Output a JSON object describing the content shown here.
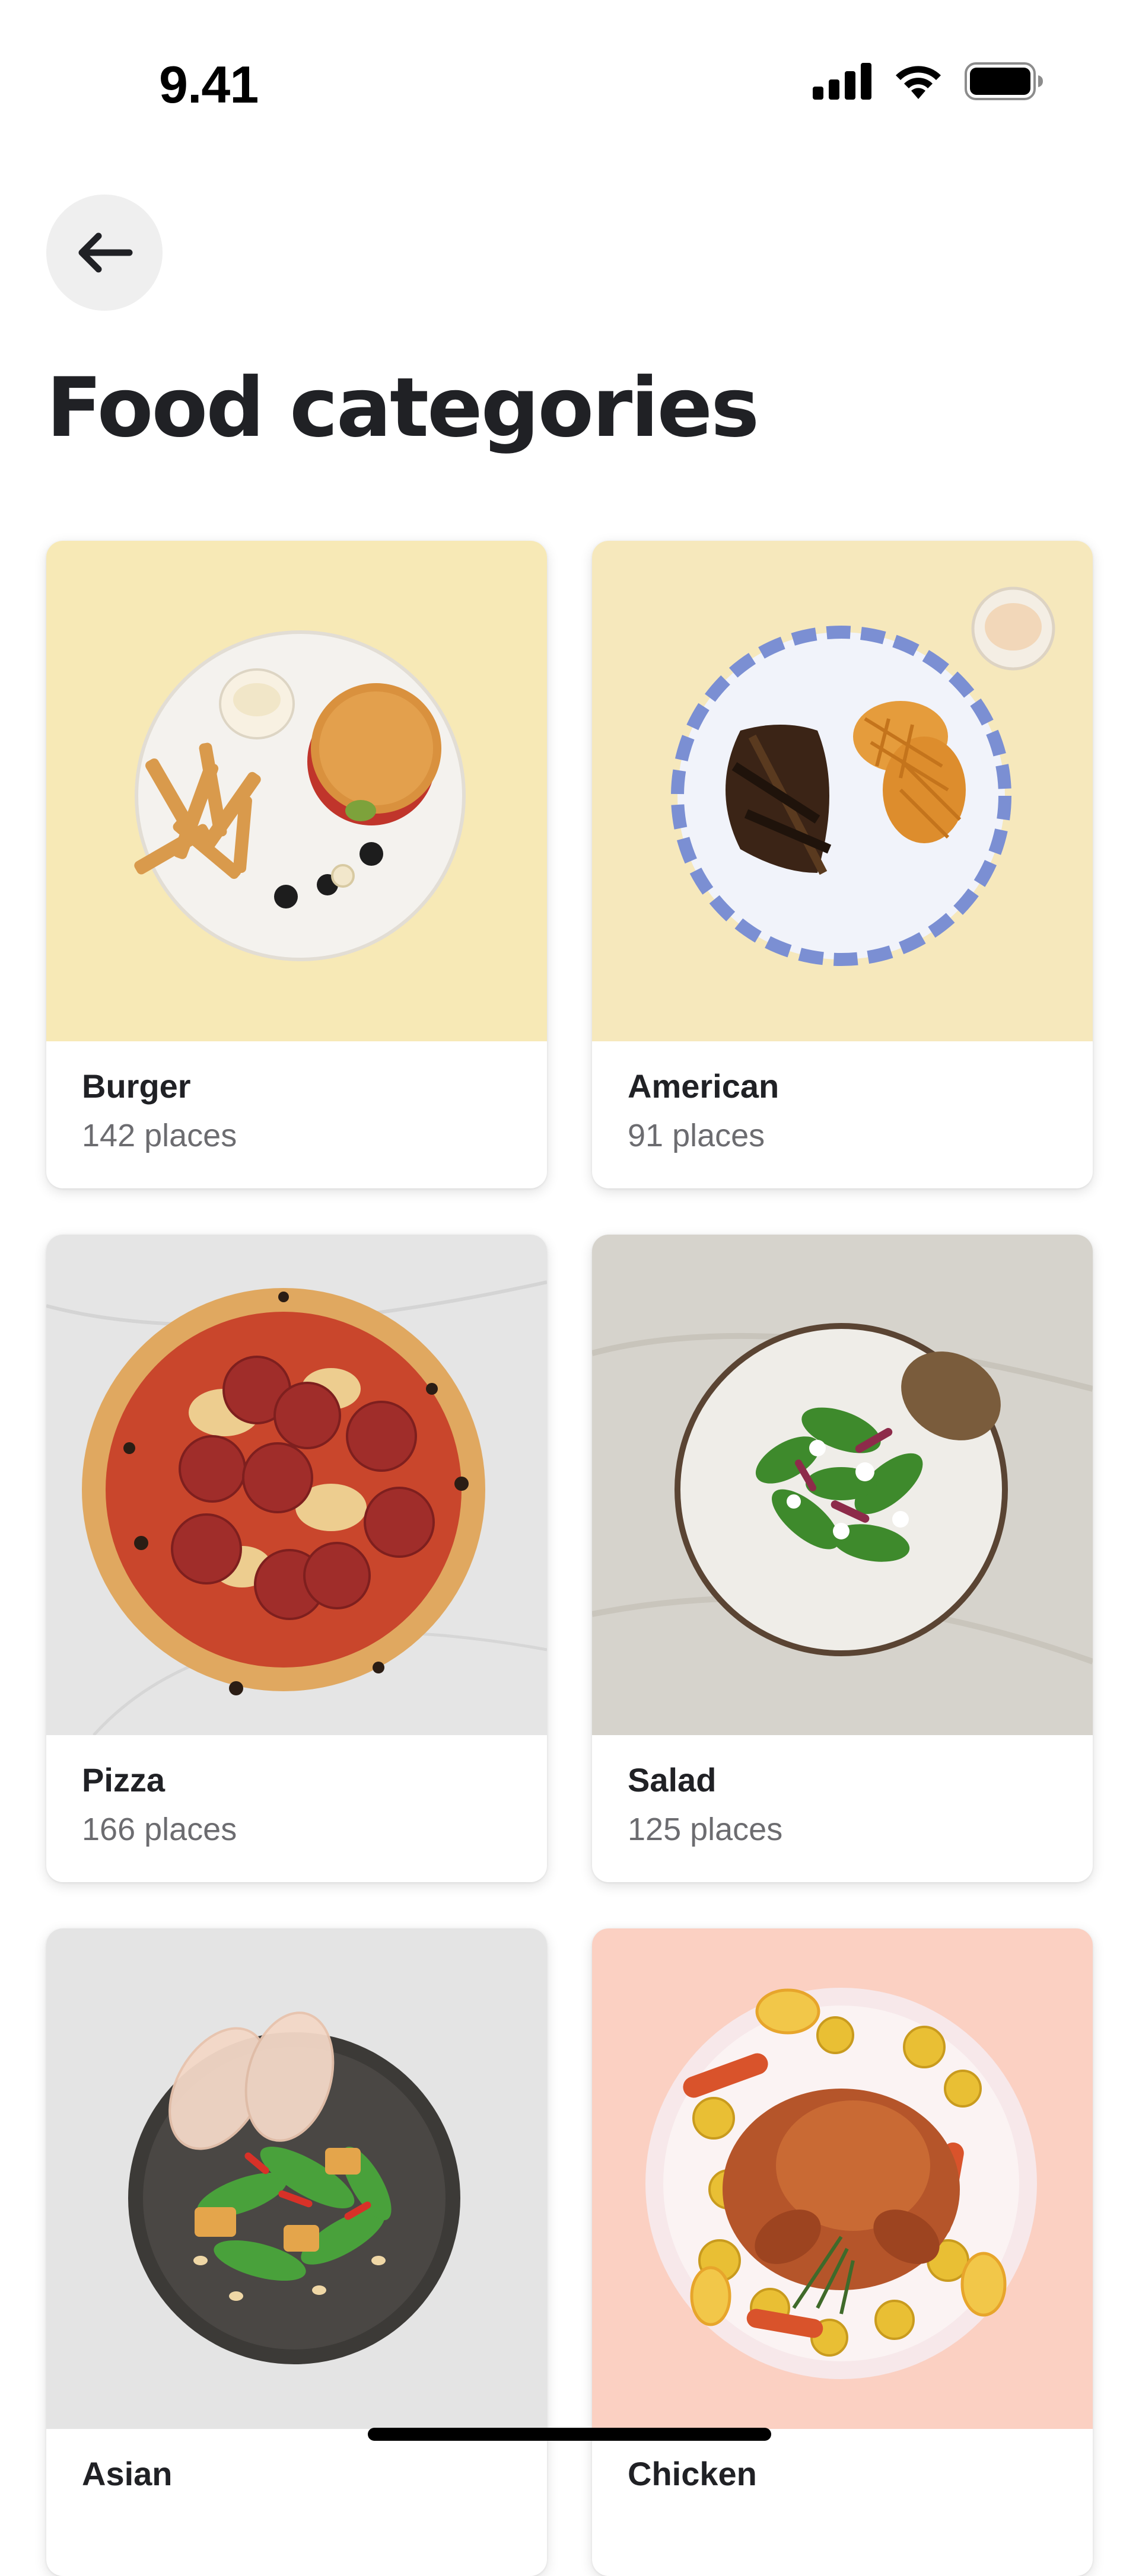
{
  "status_bar": {
    "time": "9.41",
    "icons": [
      "signal-icon",
      "wifi-icon",
      "battery-icon"
    ]
  },
  "header": {
    "back_icon": "arrow-left-icon",
    "title": "Food categories"
  },
  "categories": [
    {
      "name": "Burger",
      "count": "142 places",
      "bg_color": "#f7e9b6",
      "image": "burger-and-fries-plate"
    },
    {
      "name": "American",
      "count": "91 places",
      "bg_color": "#f6e8bc",
      "image": "ribs-and-waffle-fries-plate"
    },
    {
      "name": "Pizza",
      "count": "166 places",
      "bg_color": "#e5e5e5",
      "image": "pepperoni-pizza"
    },
    {
      "name": "Salad",
      "count": "125 places",
      "bg_color": "#d6d3cc",
      "image": "green-salad-bowl"
    },
    {
      "name": "Asian",
      "count": "",
      "bg_color": "#e4e4e4",
      "image": "asian-noodle-salad-bowl"
    },
    {
      "name": "Chicken",
      "count": "",
      "bg_color": "#fbd0c2",
      "image": "roast-chicken-plate"
    }
  ],
  "colors": {
    "title": "#202125",
    "secondary_text": "#6c6c70",
    "back_button_bg": "#efefef"
  }
}
